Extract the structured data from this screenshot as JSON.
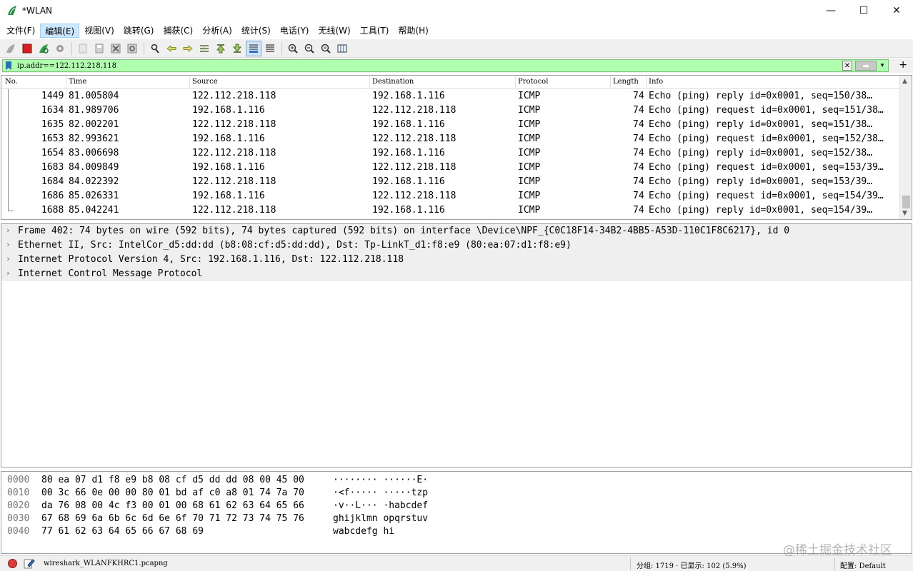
{
  "window": {
    "title": "*WLAN",
    "controls": {
      "minimize": "—",
      "maximize": "☐",
      "close": "✕"
    }
  },
  "menu": [
    {
      "label": "文件(F)"
    },
    {
      "label": "编辑(E)"
    },
    {
      "label": "视图(V)"
    },
    {
      "label": "跳转(G)"
    },
    {
      "label": "捕获(C)"
    },
    {
      "label": "分析(A)"
    },
    {
      "label": "统计(S)"
    },
    {
      "label": "电话(Y)"
    },
    {
      "label": "无线(W)"
    },
    {
      "label": "工具(T)"
    },
    {
      "label": "帮助(H)"
    }
  ],
  "filter": {
    "value": "ip.addr==122.112.218.118",
    "clear_icon": "✕",
    "apply_icon": "➡",
    "dropdown_icon": "▾",
    "add_icon": "+"
  },
  "packet_list": {
    "columns": {
      "no": "No.",
      "time": "Time",
      "source": "Source",
      "destination": "Destination",
      "protocol": "Protocol",
      "length": "Length",
      "info": "Info"
    },
    "rows": [
      {
        "no": "1449",
        "time": "81.005804",
        "source": "122.112.218.118",
        "destination": "192.168.1.116",
        "protocol": "ICMP",
        "length": "74",
        "info": "Echo (ping) reply    id=0x0001, seq=150/38…"
      },
      {
        "no": "1634",
        "time": "81.989706",
        "source": "192.168.1.116",
        "destination": "122.112.218.118",
        "protocol": "ICMP",
        "length": "74",
        "info": "Echo (ping) request  id=0x0001, seq=151/38…"
      },
      {
        "no": "1635",
        "time": "82.002201",
        "source": "122.112.218.118",
        "destination": "192.168.1.116",
        "protocol": "ICMP",
        "length": "74",
        "info": "Echo (ping) reply    id=0x0001, seq=151/38…"
      },
      {
        "no": "1653",
        "time": "82.993621",
        "source": "192.168.1.116",
        "destination": "122.112.218.118",
        "protocol": "ICMP",
        "length": "74",
        "info": "Echo (ping) request  id=0x0001, seq=152/38…"
      },
      {
        "no": "1654",
        "time": "83.006698",
        "source": "122.112.218.118",
        "destination": "192.168.1.116",
        "protocol": "ICMP",
        "length": "74",
        "info": "Echo (ping) reply    id=0x0001, seq=152/38…"
      },
      {
        "no": "1683",
        "time": "84.009849",
        "source": "192.168.1.116",
        "destination": "122.112.218.118",
        "protocol": "ICMP",
        "length": "74",
        "info": "Echo (ping) request  id=0x0001, seq=153/39…"
      },
      {
        "no": "1684",
        "time": "84.022392",
        "source": "122.112.218.118",
        "destination": "192.168.1.116",
        "protocol": "ICMP",
        "length": "74",
        "info": "Echo (ping) reply    id=0x0001, seq=153/39…"
      },
      {
        "no": "1686",
        "time": "85.026331",
        "source": "192.168.1.116",
        "destination": "122.112.218.118",
        "protocol": "ICMP",
        "length": "74",
        "info": "Echo (ping) request  id=0x0001, seq=154/39…"
      },
      {
        "no": "1688",
        "time": "85.042241",
        "source": "122.112.218.118",
        "destination": "192.168.1.116",
        "protocol": "ICMP",
        "length": "74",
        "info": "Echo (ping) reply    id=0x0001, seq=154/39…"
      }
    ]
  },
  "details": [
    {
      "text": "Frame 402: 74 bytes on wire (592 bits), 74 bytes captured (592 bits) on interface \\Device\\NPF_{C0C18F14-34B2-4BB5-A53D-110C1F8C6217}, id 0"
    },
    {
      "text": "Ethernet II, Src: IntelCor_d5:dd:dd (b8:08:cf:d5:dd:dd), Dst: Tp-LinkT_d1:f8:e9 (80:ea:07:d1:f8:e9)"
    },
    {
      "text": "Internet Protocol Version 4, Src: 192.168.1.116, Dst: 122.112.218.118"
    },
    {
      "text": "Internet Control Message Protocol"
    }
  ],
  "bytes": [
    {
      "offset": "0000",
      "hex": "80 ea 07 d1 f8 e9 b8 08  cf d5 dd dd 08 00 45 00",
      "ascii": "········ ······E·"
    },
    {
      "offset": "0010",
      "hex": "00 3c 66 0e 00 00 80 01  bd af c0 a8 01 74 7a 70",
      "ascii": "·<f····· ·····tzp"
    },
    {
      "offset": "0020",
      "hex": "da 76 08 00 4c f3 00 01  00 68 61 62 63 64 65 66",
      "ascii": "·v··L··· ·habcdef"
    },
    {
      "offset": "0030",
      "hex": "67 68 69 6a 6b 6c 6d 6e  6f 70 71 72 73 74 75 76",
      "ascii": "ghijklmn opqrstuv"
    },
    {
      "offset": "0040",
      "hex": "77 61 62 63 64 65 66 67  68 69",
      "ascii": "wabcdefg hi"
    }
  ],
  "status": {
    "file": "wireshark_WLANFKHRC1.pcapng",
    "stats": "分组: 1719 · 已显示: 102 (5.9%)",
    "profile": "配置: Default"
  },
  "watermark": "@稀土掘金技术社区",
  "colors": {
    "filter_valid": "#afffaf",
    "selected_menu": "#cce8ff",
    "record": "#d83b3b"
  }
}
